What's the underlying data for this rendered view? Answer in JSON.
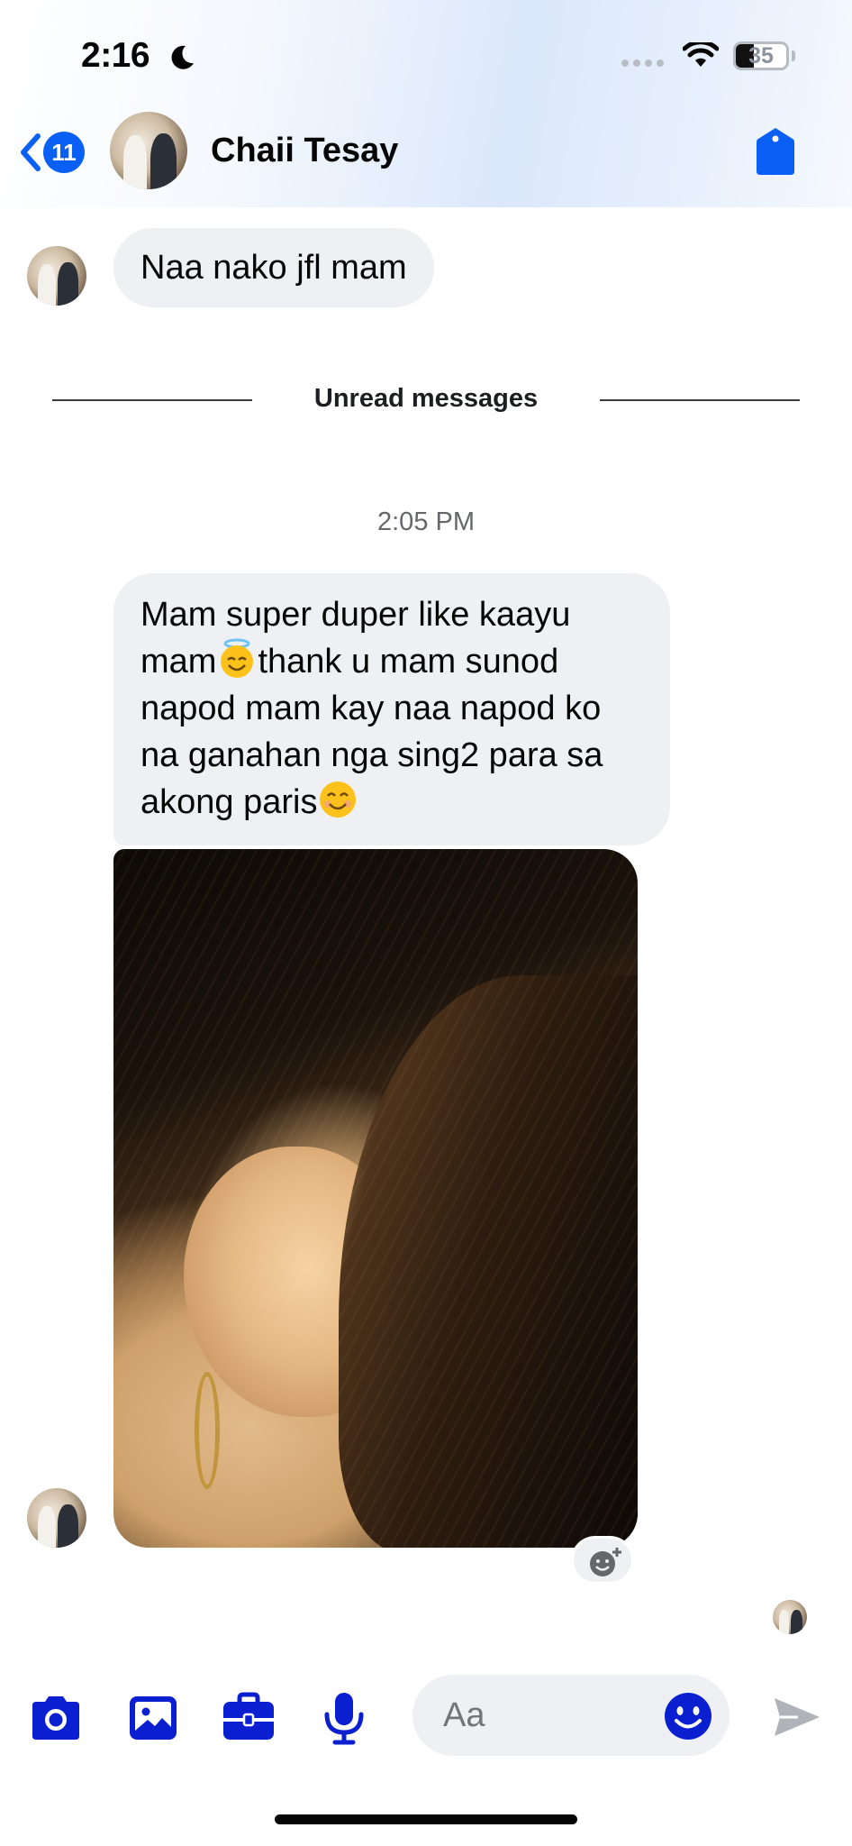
{
  "status_bar": {
    "time": "2:16",
    "battery_level": "35"
  },
  "header": {
    "unread_count": "11",
    "contact_name": "Chaii Tesay"
  },
  "messages": [
    {
      "text": "Naa nako jfl mam"
    }
  ],
  "unread_divider": {
    "label": "Unread messages"
  },
  "timestamp": "2:05 PM",
  "message_2": {
    "part1": "Mam super duper like kaayu mam",
    "part2": "thank u mam sunod napod mam kay naa napod ko na ganahan nga sing2 para sa akong paris",
    "emoji_1": "smiling-face-with-halo",
    "emoji_2": "smiling-face-with-smiling-eyes"
  },
  "photo_attachment": {
    "description_icon": "photo-of-ear-with-hair-and-hoop-earring"
  },
  "composer": {
    "placeholder": "Aa"
  },
  "colors": {
    "accent": "#0a60f5",
    "icon_blue": "#0a1fd0",
    "bubble_bg": "#eff0f4"
  }
}
